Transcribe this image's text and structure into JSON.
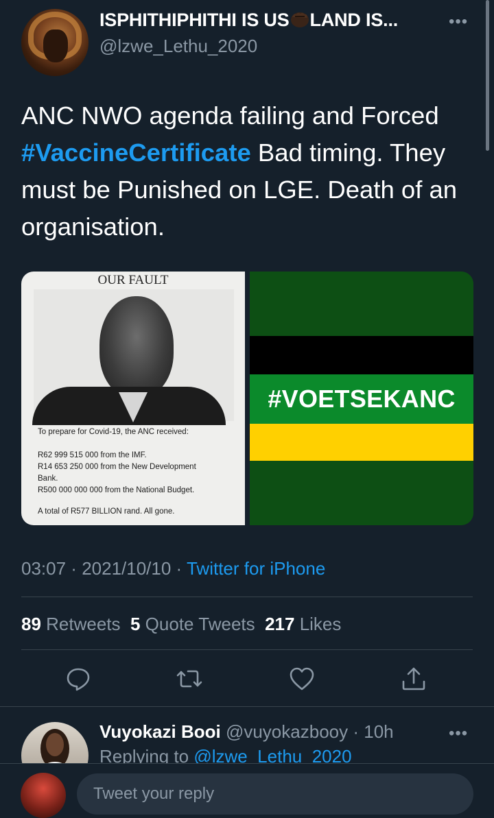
{
  "tweet": {
    "author_name": "ISPHITHIPHITHI IS US",
    "author_name_suffix": "LAND IS...",
    "author_handle": "@lzwe_Lethu_2020",
    "more_label": "•••",
    "text_part1": "ANC NWO agenda failing and Forced ",
    "hashtag": "#VaccineCertificate",
    "text_part2": " Bad timing. They must be Punished on LGE. Death of an organisation.",
    "media_left": {
      "title": "OUR FAULT",
      "lines": [
        "To prepare for Covid-19, the ANC received:",
        "R62 999 515 000 from the IMF.",
        "R14 653 250 000 from the New Development",
        "Bank.",
        "R500 000 000 000 from the National Budget.",
        "A total of R577 BILLION rand. All gone."
      ]
    },
    "media_right": {
      "label": "#VOETSEKANC",
      "colors": {
        "green_dark": "#0d4f14",
        "black": "#000000",
        "green": "#0b8a2b",
        "gold": "#ffd000"
      }
    },
    "time": "03:07",
    "sep1": " · ",
    "date": "2021/10/10",
    "sep2": " · ",
    "source": "Twitter for iPhone",
    "retweets_count": "89",
    "retweets_label": " Retweets",
    "quotes_count": "5",
    "quotes_label": " Quote Tweets",
    "likes_count": "217",
    "likes_label": " Likes"
  },
  "actions": [
    "reply-icon",
    "retweet-icon",
    "like-icon",
    "share-icon"
  ],
  "reply": {
    "name": "Vuyokazi Booi",
    "handle": " @vuyokazbooy",
    "time": " · 10h",
    "more_label": "•••",
    "replying_prefix": "Replying to ",
    "replying_to": "@lzwe_Lethu_2020"
  },
  "composer": {
    "placeholder": "Tweet your reply"
  },
  "colors": {
    "background": "#15202b",
    "accent": "#1d9bf0",
    "secondary_text": "#8b98a5",
    "divider": "#38444d"
  }
}
